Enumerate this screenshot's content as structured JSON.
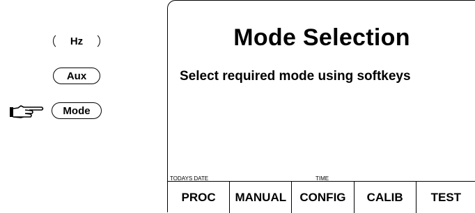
{
  "hardkeys": [
    {
      "label": "Hz"
    },
    {
      "label": "Aux"
    },
    {
      "label": "Mode"
    }
  ],
  "pointer_icon": "pointing-hand-icon",
  "screen": {
    "title": "Mode Selection",
    "subtitle": "Select required mode using softkeys",
    "date_label": "TODAYS DATE",
    "time_label": "TIME"
  },
  "softkeys": [
    {
      "label": "PROC"
    },
    {
      "label": "MANUAL"
    },
    {
      "label": "CONFIG"
    },
    {
      "label": "CALIB"
    },
    {
      "label": "TEST"
    }
  ]
}
